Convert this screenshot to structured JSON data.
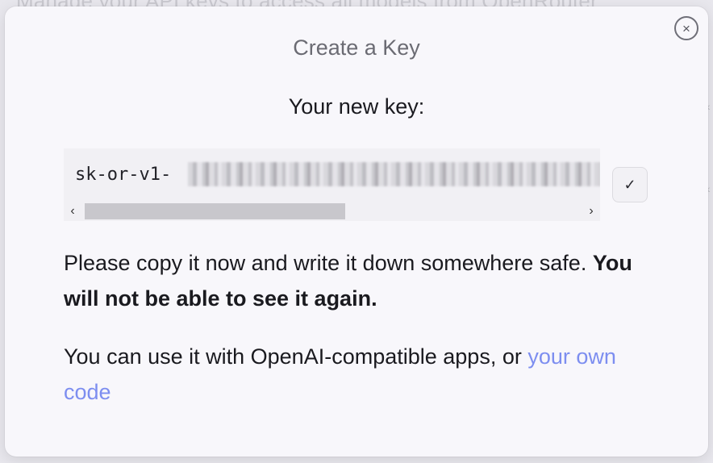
{
  "background": {
    "text": "Manage your API keys to access all models from OpenRouter"
  },
  "modal": {
    "title": "Create a Key",
    "subtitle": "Your new key:",
    "key": {
      "prefix": "sk-or-v1-",
      "blurred": true
    },
    "copy_icon": "check-icon",
    "copy_symbol": "✓",
    "close_symbol": "×",
    "scroll_left": "‹",
    "scroll_right": "›",
    "paragraph1": {
      "text": "Please copy it now and write it down somewhere safe. ",
      "bold": "You will not be able to see it again."
    },
    "paragraph2": {
      "text": "You can use it with OpenAI-compatible apps, or ",
      "link": "your own code"
    }
  },
  "colors": {
    "accent_link": "#7d8ef0",
    "modal_bg": "#f8f7fb"
  }
}
